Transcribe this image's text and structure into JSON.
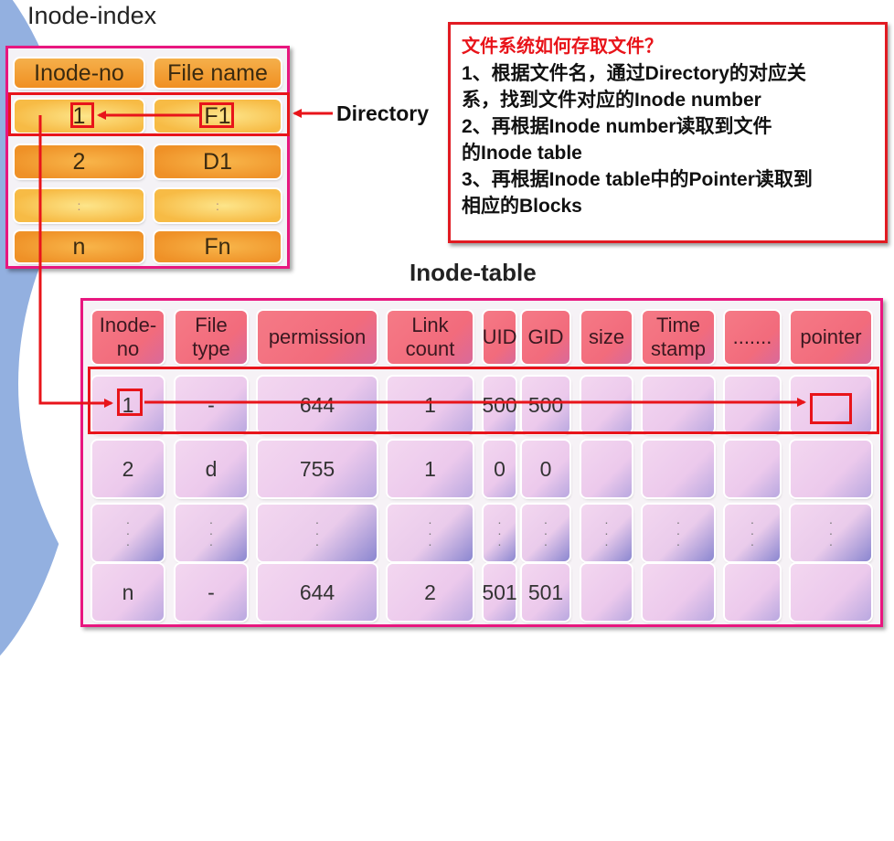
{
  "inode_index": {
    "title": "Inode-index",
    "headers": [
      "Inode-no",
      "File name"
    ],
    "rows": [
      [
        "1",
        "F1"
      ],
      [
        "2",
        "D1"
      ],
      [
        ":",
        ":"
      ],
      [
        "n",
        "Fn"
      ]
    ]
  },
  "directory_label": "Directory",
  "note": {
    "title": "文件系统如何存取文件？",
    "lines": [
      "1、根据文件名，通过Directory的对应关",
      "系，找到文件对应的Inode number",
      "2、再根据Inode number读取到文件",
      "的Inode table",
      "3、再根据Inode table中的Pointer读取到",
      "相应的Blocks"
    ]
  },
  "inode_table": {
    "title": "Inode-table",
    "headers": [
      [
        "Inode-",
        "no"
      ],
      [
        "File",
        "type"
      ],
      [
        "permission"
      ],
      [
        "Link",
        "count"
      ],
      [
        "UID"
      ],
      [
        "GID"
      ],
      [
        "size"
      ],
      [
        "Time",
        "stamp"
      ],
      [
        "......."
      ],
      [
        "pointer"
      ]
    ],
    "rows": [
      [
        "1",
        "-",
        "644",
        "1",
        "500",
        "500",
        "",
        "",
        "",
        ""
      ],
      [
        "2",
        "d",
        "755",
        "1",
        "0",
        "0",
        "",
        "",
        "",
        ""
      ],
      [
        ":",
        ":",
        ":",
        ":",
        ":",
        ":",
        ":",
        ":",
        ":",
        ":"
      ],
      [
        "n",
        "-",
        "644",
        "2",
        "501",
        "501",
        "",
        "",
        "",
        ""
      ]
    ]
  },
  "colors": {
    "frame": "#e8177f",
    "highlight": "#e8141a",
    "index_header": "#f08f22",
    "table_header": "#f26b7c",
    "table_body": "#ecc9ec",
    "background_swoosh": "#93b0e0"
  }
}
